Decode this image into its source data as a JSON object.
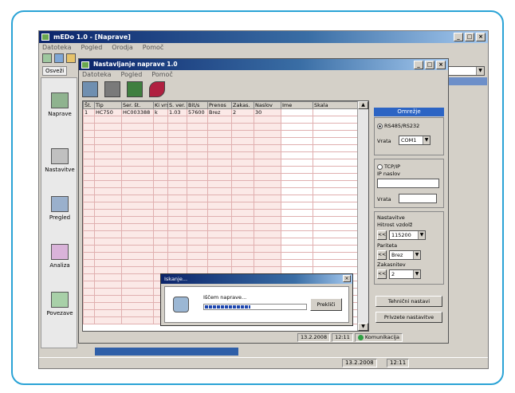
{
  "main_window": {
    "title": "mEDo 1.0 - [Naprave]",
    "menu": [
      "Datoteka",
      "Pogled",
      "Orodja",
      "Pomoč"
    ],
    "address_button": "Osveži",
    "sidebar": [
      "Naprave",
      "Nastavitve",
      "Pregled",
      "Analiza",
      "Povezave"
    ],
    "status": {
      "date": "13.2.2008",
      "time": "12:11"
    }
  },
  "child_window": {
    "title": "Nastavljanje naprave 1.0",
    "menu": [
      "Datoteka",
      "Pogled",
      "Pomoč"
    ],
    "grid": {
      "columns": [
        "Št.",
        "Tip",
        "Ser. št.",
        "Ki vrsta",
        "S. ver.",
        "Bit/s",
        "Prenos",
        "Zakas.",
        "Naslov",
        "Ime",
        "Skala"
      ],
      "rows": [
        [
          "1",
          "HC750",
          "HC003388",
          "k",
          "1.03",
          "57600",
          "Brez",
          "2",
          "30",
          "",
          ""
        ]
      ]
    },
    "panel": {
      "header": "Omrežje",
      "rs_option": "RS485/RS232",
      "port_label": "Vrata",
      "port_value": "COM1",
      "tcp_option": "TCP/IP",
      "ip_label": "IP naslov",
      "vrata2_label": "Vrata",
      "settings_title": "Nastavitve",
      "speed_label": "Hitrost vzdolž",
      "speed_value": "115200",
      "parity_label": "Pariteta",
      "parity_value": "Brez",
      "delay_label": "Zakasnitev",
      "delay_value": "2",
      "button1": "Tehnični nastavi",
      "button2": "Privzete nastavitve"
    },
    "status": {
      "date": "13.2.2008",
      "time": "12:11",
      "connection": "Komunikacija"
    }
  },
  "dialog": {
    "title": "Iskanje...",
    "label": "Iščem naprave...",
    "progress": 0.45,
    "button": "Prekliči"
  }
}
